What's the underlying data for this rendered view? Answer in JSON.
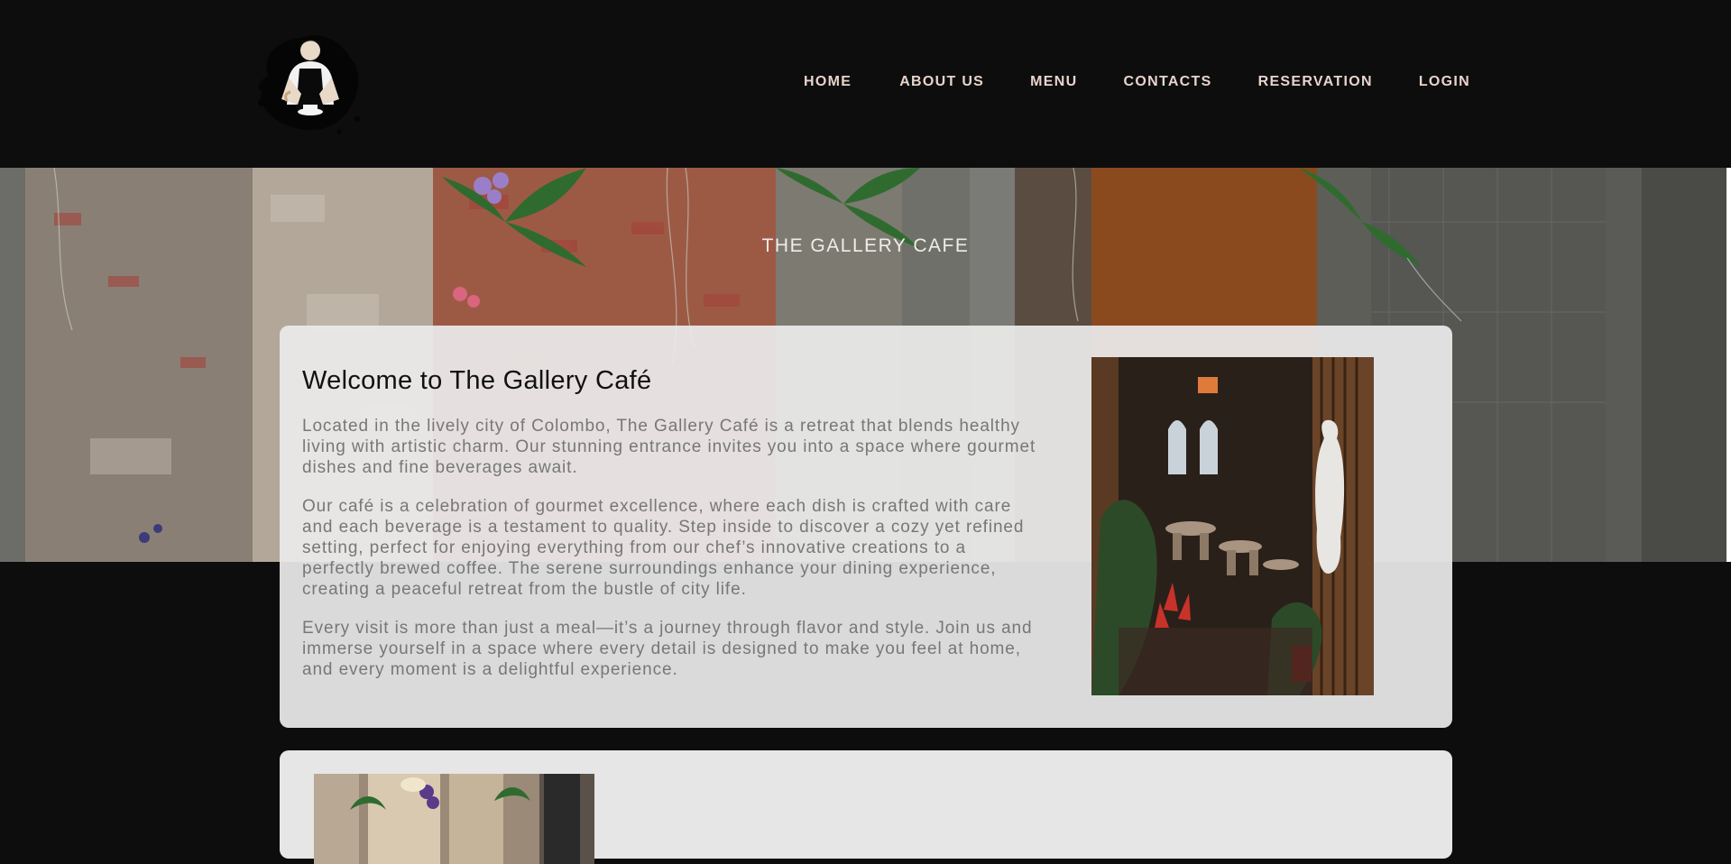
{
  "nav": {
    "items": [
      {
        "label": "HOME"
      },
      {
        "label": "ABOUT US"
      },
      {
        "label": "MENU"
      },
      {
        "label": "CONTACTS"
      },
      {
        "label": "RESERVATION"
      },
      {
        "label": "LOGIN"
      }
    ]
  },
  "hero": {
    "title": "THE GALLERY CAFE"
  },
  "welcome": {
    "title": "Welcome to The Gallery Café",
    "paragraphs": [
      "Located in the lively city of Colombo, The Gallery Café is a retreat that blends healthy living with artistic charm. Our stunning entrance invites you into a space where gourmet dishes and fine beverages await.",
      "Our café is a celebration of gourmet excellence, where each dish is crafted with care and each beverage is a testament to quality. Step inside to discover a cozy yet refined setting, perfect for enjoying everything from our chef’s innovative creations to a perfectly brewed coffee. The serene surroundings enhance your dining experience, creating a peaceful retreat from the bustle of city life.",
      "Every visit is more than just a meal—it’s a journey through flavor and style. Join us and immerse yourself in a space where every detail is designed to make you feel at home, and every moment is a delightful experience."
    ]
  },
  "colors": {
    "header_bg": "#0d0d0d",
    "nav_text": "#e8d4cc",
    "card_bg": "#ebebeb",
    "card_title": "#111111",
    "card_body": "#777777"
  },
  "icons": {
    "logo": "barista-logo"
  }
}
